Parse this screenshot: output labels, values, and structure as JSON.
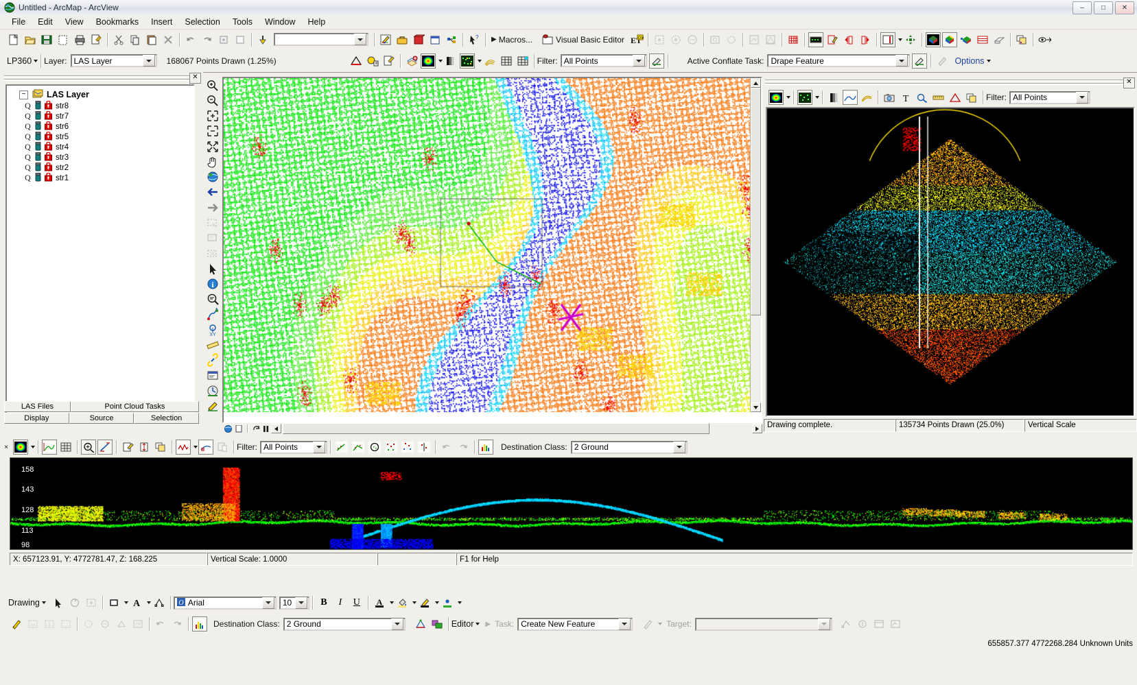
{
  "window": {
    "title": "Untitled - ArcMap - ArcView",
    "app_icon": "globe-icon",
    "minimize": "–",
    "maximize": "□",
    "close": "✕"
  },
  "menubar": {
    "items": [
      "File",
      "Edit",
      "View",
      "Bookmarks",
      "Insert",
      "Selection",
      "Tools",
      "Window",
      "Help"
    ]
  },
  "standard_toolbar": {
    "icons": [
      "new-document-icon",
      "open-folder-icon",
      "save-icon",
      "print-preview-icon",
      "print-icon",
      "page-setup-icon",
      "cut-icon",
      "copy-icon",
      "paste-icon",
      "delete-icon",
      "undo-icon",
      "redo-icon",
      "add-data-icon",
      "new-layer-icon",
      "add-data-arrow-icon"
    ],
    "scale_value": "",
    "scale_placeholder": "",
    "after_icons": [
      "editor-pencil-icon",
      "globe-3d-icon",
      "toolbox-icon",
      "command-line-icon",
      "model-builder-icon",
      "whats-this-icon"
    ],
    "macros_label": "Macros...",
    "vba_label": "Visual Basic Editor",
    "et_label": "ET"
  },
  "lp360_toolbar": {
    "product_label": "LP360",
    "layer_label": "Layer:",
    "layer_value": "LAS Layer",
    "points_drawn": "168067 Points Drawn (1.25%)",
    "filter_label": "Filter:",
    "filter_value": "All Points",
    "conflate_label": "Active Conflate Task:",
    "conflate_value": "Drape Feature",
    "options_label": "Options",
    "icons": [
      "tin-triangle-icon",
      "point-info-icon",
      "layer-properties-icon",
      "layer-stack-icon",
      "color-ramp-icon",
      "grayscale-ramp-icon",
      "point-density-icon",
      "grid-icon",
      "grid-selected-icon",
      "conflate-edit-icon",
      "pencil-disabled-icon"
    ]
  },
  "toc": {
    "close_button": "✕",
    "root_label": "LAS Layer",
    "root_icon": "las-layer-icon",
    "expander": "−",
    "items": [
      {
        "label": "str8",
        "query_icon": "query-icon",
        "battery_icon": "status-icon",
        "lock_icon": "lock-icon"
      },
      {
        "label": "str7",
        "query_icon": "query-icon",
        "battery_icon": "status-icon",
        "lock_icon": "lock-icon"
      },
      {
        "label": "str6",
        "query_icon": "query-icon",
        "battery_icon": "status-icon",
        "lock_icon": "lock-icon"
      },
      {
        "label": "str5",
        "query_icon": "query-icon",
        "battery_icon": "status-icon",
        "lock_icon": "lock-icon"
      },
      {
        "label": "str4",
        "query_icon": "query-icon",
        "battery_icon": "status-icon",
        "lock_icon": "lock-icon"
      },
      {
        "label": "str3",
        "query_icon": "query-icon",
        "battery_icon": "status-icon",
        "lock_icon": "lock-icon"
      },
      {
        "label": "str2",
        "query_icon": "query-icon",
        "battery_icon": "status-icon",
        "lock_icon": "lock-icon"
      },
      {
        "label": "str1",
        "query_icon": "query-icon",
        "battery_icon": "status-icon",
        "lock_icon": "lock-icon"
      }
    ],
    "tabs_row1": [
      "LAS Files",
      "Point Cloud Tasks"
    ],
    "tabs_row2": [
      "Display",
      "Source",
      "Selection"
    ]
  },
  "map_tools": {
    "icons": [
      "zoom-in-icon",
      "zoom-out-icon",
      "pan-fixed-zoom-in-icon",
      "fixed-zoom-out-icon",
      "full-extent-icon",
      "pan-hand-icon",
      "globe-extent-icon",
      "back-extent-icon",
      "forward-extent-icon",
      "select-features-icon",
      "select-by-rect-icon",
      "clear-selection-icon",
      "select-elements-icon",
      "identify-icon",
      "find-icon",
      "find-route-icon",
      "go-to-xy-icon",
      "measure-icon",
      "hyperlink-icon",
      "html-popup-icon",
      "time-slider-icon",
      "edit-vertices-icon"
    ]
  },
  "threed_view": {
    "close_button": "✕",
    "toolbar_icons": [
      "color-ramp-icon",
      "point-density-icon",
      "vertical-bar-icon",
      "profile-view-icon",
      "cross-section-icon",
      "camera-icon",
      "text-tool-icon",
      "magnify-icon",
      "measure-profile-icon",
      "warning-triangle-icon",
      "copy-icon"
    ],
    "filter_label": "Filter:",
    "filter_value": "All Points",
    "status": {
      "drawing": "Drawing complete.",
      "points": "135734 Points Drawn (25.0%)",
      "vertical_scale": "Vertical Scale"
    }
  },
  "profile_view": {
    "toolbar_icons": [
      "color-ramp-icon",
      "profile-settings-icon",
      "grid-toggle-icon",
      "zoom-profile-icon",
      "measure-icon",
      "properties-icon",
      "vertical-extent-icon",
      "copy-icon",
      "waveform-icon",
      "reclass-icon",
      "export-disabled-icon"
    ],
    "filter_label": "Filter:",
    "filter_value": "All Points",
    "class_tools": [
      "class-line-icon",
      "class-surface-icon",
      "class-circle-icon",
      "class-points-a-icon",
      "class-points-b-icon",
      "class-points-c-icon"
    ],
    "undo_icon": "undo-icon",
    "redo_icon": "redo-icon",
    "histogram_icon": "histogram-icon",
    "destination_label": "Destination Class:",
    "destination_value": "2  Ground",
    "y_axis_labels": [
      "158",
      "143",
      "128",
      "113",
      "98"
    ],
    "status": {
      "coords": "X: 657123.91, Y: 4772781.47, Z: 168.225",
      "vertical_scale": "Vertical Scale: 1.0000",
      "blank": "",
      "help": "F1 for Help"
    }
  },
  "drawing_toolbar": {
    "label": "Drawing",
    "icons": [
      "select-arrow-icon",
      "rotate-icon",
      "drawing-tools-icon",
      "rectangle-icon",
      "new-text-icon",
      "point-text-icon"
    ],
    "font_icon": "font-o-icon",
    "font_value": "Arial",
    "size_value": "10",
    "bold": "B",
    "italic": "I",
    "underline": "U",
    "font_color_icon": "font-color-icon",
    "fill_color_icon": "fill-color-icon",
    "line_color_icon": "line-color-icon",
    "marker_color_icon": "marker-color-icon"
  },
  "editor_toolbar": {
    "icons": [
      "pencil-icon",
      "classify-1-icon",
      "classify-2-icon",
      "classify-3-icon",
      "classify-4-icon",
      "classify-5-icon",
      "classify-6-icon",
      "classify-7-icon",
      "undo-icon",
      "redo-icon",
      "histogram-icon"
    ],
    "destination_label": "Destination Class:",
    "destination_value": "2  Ground",
    "extra_icons": [
      "tin-edit-icon",
      "conflate-icon"
    ],
    "editor_label": "Editor",
    "task_label": "Task:",
    "task_value": "Create New Feature",
    "target_label": "Target:",
    "target_value": "",
    "tail_icons": [
      "sketch-tool-icon",
      "sketch-props-icon",
      "attributes-icon",
      "edit-window-icon"
    ],
    "coords": "655857.377  4772268.284 Unknown Units"
  },
  "colors": {
    "chrome": "#f0efe9",
    "title_gradient_top": "#f6f7f9",
    "canvas_black": "#000000",
    "accent_red": "#e00000",
    "accent_green": "#00d400",
    "accent_blue": "#0000ee",
    "accent_cyan": "#00d8d8",
    "accent_yellow": "#ffe500",
    "magenta_marker": "#cc00cc"
  }
}
